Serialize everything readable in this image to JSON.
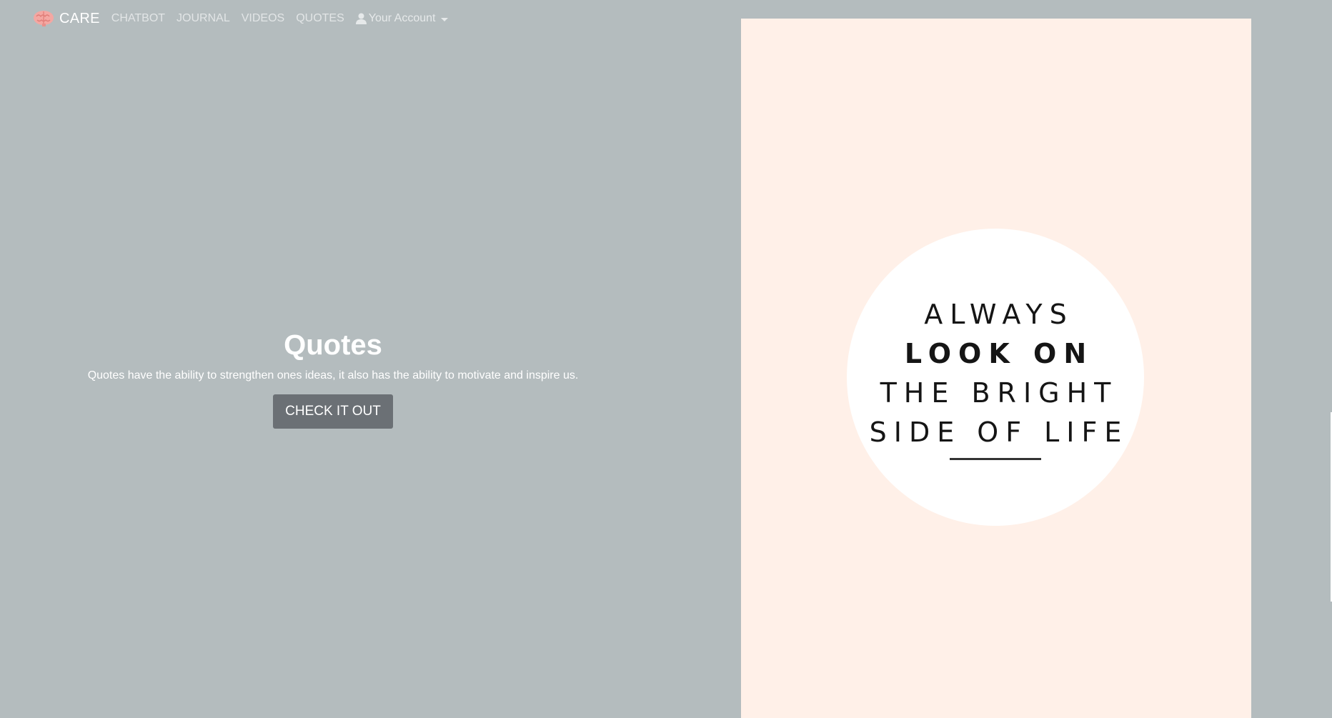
{
  "nav": {
    "brand": "CARE",
    "links": [
      "CHATBOT",
      "JOURNAL",
      "VIDEOS",
      "QUOTES"
    ],
    "account_label": "Your Account",
    "brand_color": "#f4a7a2",
    "icons": {
      "logo": "brain-icon",
      "account": "user-icon",
      "dropdown": "caret-down-icon"
    }
  },
  "hero": {
    "title": "Quotes",
    "description": "Quotes have the ability to strengthen ones ideas, it also has the ability to motivate and inspire us.",
    "button_label": "CHECK IT OUT"
  },
  "quote_image": {
    "lines": [
      "ALWAYS",
      "LOOK ON",
      "THE BRIGHT",
      "SIDE OF LIFE"
    ],
    "background_color": "#fff0e8"
  },
  "colors": {
    "page_background": "#b4bcbe",
    "button_background": "#6b7075"
  }
}
